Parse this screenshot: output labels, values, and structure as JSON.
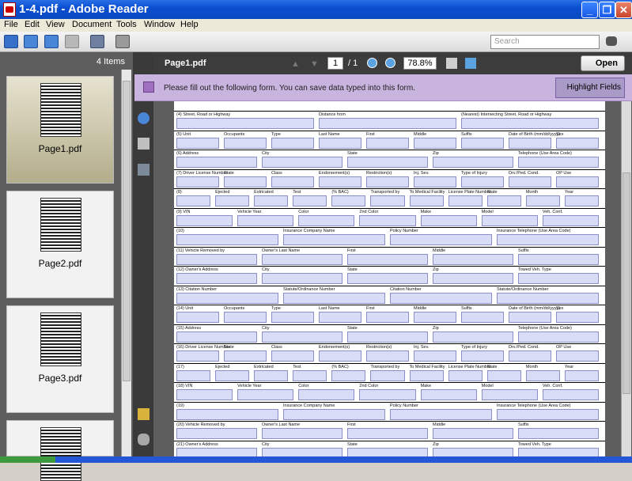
{
  "window": {
    "title": "1-4.pdf - Adobe Reader"
  },
  "menu": [
    "File",
    "Edit",
    "View",
    "Document",
    "Tools",
    "Window",
    "Help"
  ],
  "toolbar": {
    "search_placeholder": "Search"
  },
  "sidebar": {
    "count": "4 Items",
    "thumbs": [
      {
        "label": "Page1.pdf"
      },
      {
        "label": "Page2.pdf"
      },
      {
        "label": "Page3.pdf"
      }
    ]
  },
  "docbar": {
    "filename": "Page1.pdf",
    "page_current": "1",
    "page_total": "/ 1",
    "zoom": "78.8%",
    "open_label": "Open"
  },
  "notice": {
    "message": "Please fill out the following form. You can save data typed into this form.",
    "highlight_label": "Highlight Fields"
  },
  "form_rows": [
    {
      "labels": [
        "(4) Street, Road or Highway",
        "Distance from",
        "(Nearest) Intersecting Street, Road or Highway"
      ]
    },
    {
      "labels": [
        "(5) Unit",
        "Occupants",
        "Type",
        "Last Name",
        "First",
        "Middle",
        "Suffix",
        "Date of Birth (mm/dd/yyyy)",
        "Sex"
      ]
    },
    {
      "labels": [
        "(6) Address",
        "City",
        "State",
        "Zip",
        "Telephone (Use Area Code)"
      ]
    },
    {
      "labels": [
        "(7) Driver License Number",
        "State",
        "Class",
        "Endorsement(s)",
        "Restriction(s)",
        "Inj. Sev.",
        "Type of Injury",
        "Drv./Ped. Cond.",
        "OP Use"
      ]
    },
    {
      "labels": [
        "(8)",
        "Ejected",
        "Extricated",
        "Test",
        "(% BAC)",
        "Transported by",
        "To Medical Facility",
        "License Plate Number",
        "State",
        "Month",
        "Year"
      ]
    },
    {
      "labels": [
        "(9) VIN",
        "Vehicle Year",
        "Color",
        "2nd Color",
        "Make",
        "Model",
        "Veh. Conf."
      ]
    },
    {
      "labels": [
        "(10)",
        "Insurance Company Name",
        "Policy Number",
        "Insurance Telephone (Use Area Code)"
      ]
    },
    {
      "labels": [
        "(11) Vehicle Removed by",
        "Owner's Last Name",
        "First",
        "Middle",
        "Suffix"
      ]
    },
    {
      "labels": [
        "(12) Owner's Address",
        "City",
        "State",
        "Zip",
        "Towed Veh. Type"
      ]
    },
    {
      "labels": [
        "(13) Citation Number",
        "Statute/Ordinance Number",
        "Citation Number",
        "Statute/Ordinance Number"
      ]
    },
    {
      "labels": [
        "(14) Unit",
        "Occupants",
        "Type",
        "Last Name",
        "First",
        "Middle",
        "Suffix",
        "Date of Birth (mm/dd/yyyy)",
        "Sex"
      ]
    },
    {
      "labels": [
        "(15) Address",
        "City",
        "State",
        "Zip",
        "Telephone (Use Area Code)"
      ]
    },
    {
      "labels": [
        "(16) Driver License Number",
        "State",
        "Class",
        "Endorsement(s)",
        "Restriction(s)",
        "Inj. Sev.",
        "Type of Injury",
        "Drv./Ped. Cond.",
        "OP Use"
      ]
    },
    {
      "labels": [
        "(17)",
        "Ejected",
        "Extricated",
        "Test",
        "(% BAC)",
        "Transported by",
        "To Medical Facility",
        "License Plate Number",
        "State",
        "Month",
        "Year"
      ]
    },
    {
      "labels": [
        "(18) VIN",
        "Vehicle Year",
        "Color",
        "2nd Color",
        "Make",
        "Model",
        "Veh. Conf."
      ]
    },
    {
      "labels": [
        "(19)",
        "Insurance Company Name",
        "Policy Number",
        "Insurance Telephone (Use Area Code)"
      ]
    },
    {
      "labels": [
        "(20) Vehicle Removed by",
        "Owner's Last Name",
        "First",
        "Middle",
        "Suffix"
      ]
    },
    {
      "labels": [
        "(21) Owner's Address",
        "City",
        "State",
        "Zip",
        "Towed Veh. Type"
      ]
    }
  ],
  "colors": {
    "titlebar": "#0a4fd0",
    "notice": "#c9b3df",
    "field": "#d8dcf6",
    "panel": "#5e5e5e"
  }
}
